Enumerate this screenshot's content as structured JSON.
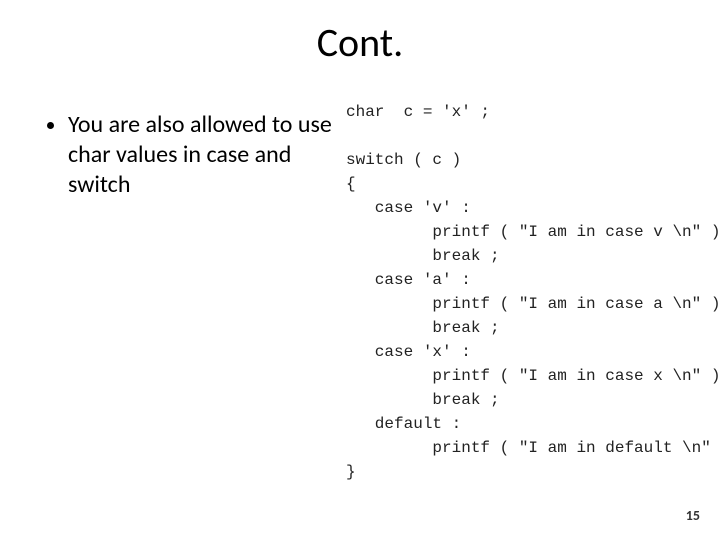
{
  "title": "Cont.",
  "bullet": {
    "pre": "You are also allowed to use ",
    "kw1": "char",
    "mid1": " values in ",
    "kw2": "case",
    "mid2": " and ",
    "kw3": "switch"
  },
  "code": "char  c = 'x' ;\n\nswitch ( c )\n{\n   case 'v' :\n         printf ( \"I am in case v \\n\" ) ;\n         break ;\n   case 'a' :\n         printf ( \"I am in case a \\n\" ) ;\n         break ;\n   case 'x' :\n         printf ( \"I am in case x \\n\" ) ;\n         break ;\n   default :\n         printf ( \"I am in default \\n\" ) ;\n}",
  "page_number": "15"
}
